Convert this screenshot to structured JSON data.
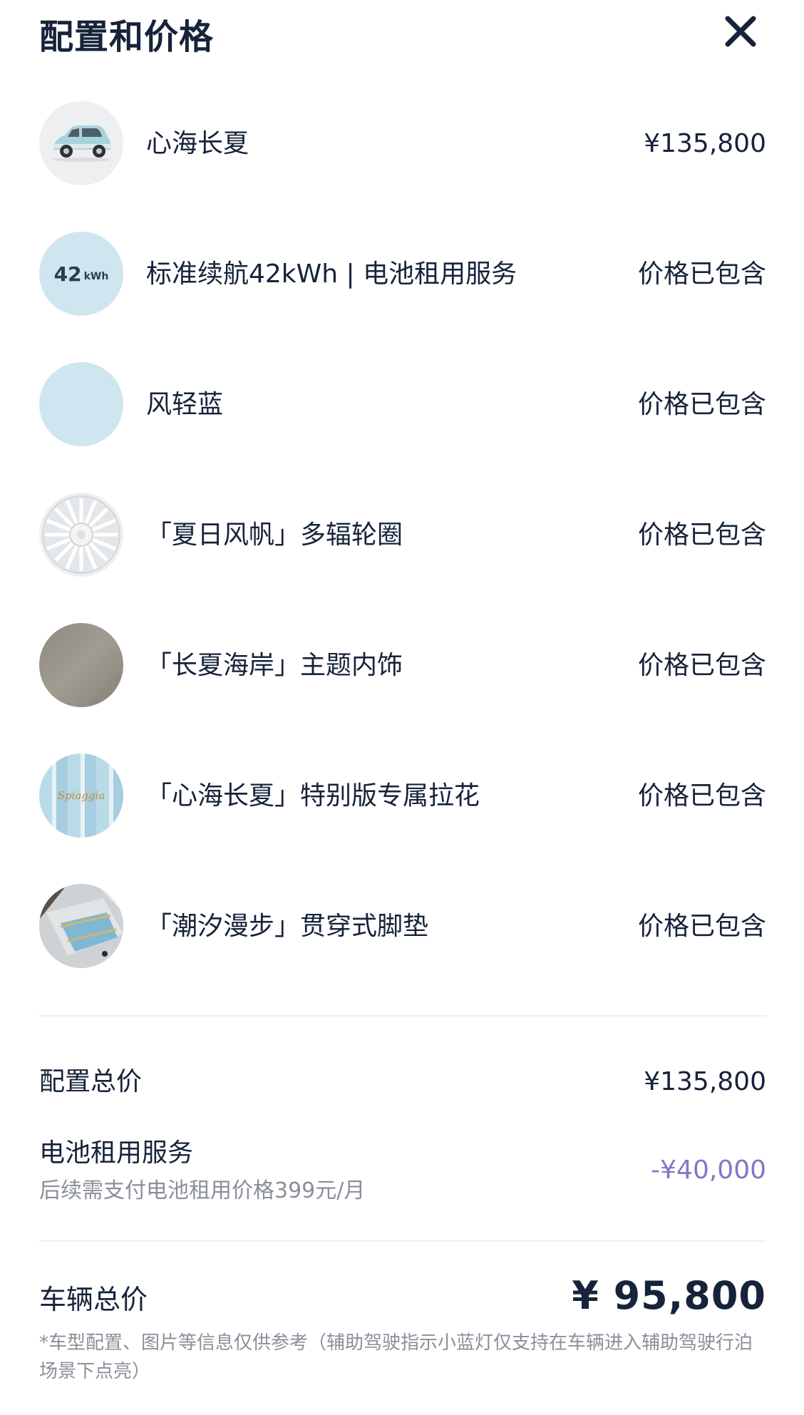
{
  "header": {
    "title": "配置和价格",
    "close_icon": "close-icon"
  },
  "items": [
    {
      "name": "心海长夏",
      "price": "¥135,800",
      "thumb": "car-thumbnail"
    },
    {
      "name": "标准续航42kWh | 电池租用服务",
      "price": "价格已包含",
      "thumb": "battery-badge",
      "badge_number": "42",
      "badge_unit": "kWh"
    },
    {
      "name": "风轻蓝",
      "price": "价格已包含",
      "thumb": "color-swatch",
      "swatch_color": "#cfe6f0"
    },
    {
      "name": "「夏日风帆」多辐轮圈",
      "price": "价格已包含",
      "thumb": "wheel-thumbnail"
    },
    {
      "name": "「长夏海岸」主题内饰",
      "price": "价格已包含",
      "thumb": "interior-swatch",
      "swatch_color": "#8f8a80"
    },
    {
      "name": "「心海长夏」特别版专属拉花",
      "price": "价格已包含",
      "thumb": "decal-thumbnail",
      "decal_text": "Spiaggia"
    },
    {
      "name": "「潮汐漫步」贯穿式脚垫",
      "price": "价格已包含",
      "thumb": "floor-mat-thumbnail"
    }
  ],
  "summary": {
    "config_total_label": "配置总价",
    "config_total_value": "¥135,800",
    "battery_label": "电池租用服务",
    "battery_note": "后续需支付电池租用价格399元/月",
    "battery_value": "-¥40,000",
    "vehicle_total_label": "车辆总价",
    "vehicle_total_value": "¥ 95,800"
  },
  "disclaimer": "*车型配置、图片等信息仅供参考（辅助驾驶指示小蓝灯仅支持在车辆进入辅助驾驶行泊场景下点亮）",
  "colors": {
    "text_primary": "#16233a",
    "text_secondary": "#8a8f99",
    "discount": "#7f78c6",
    "divider": "#eceef1"
  }
}
